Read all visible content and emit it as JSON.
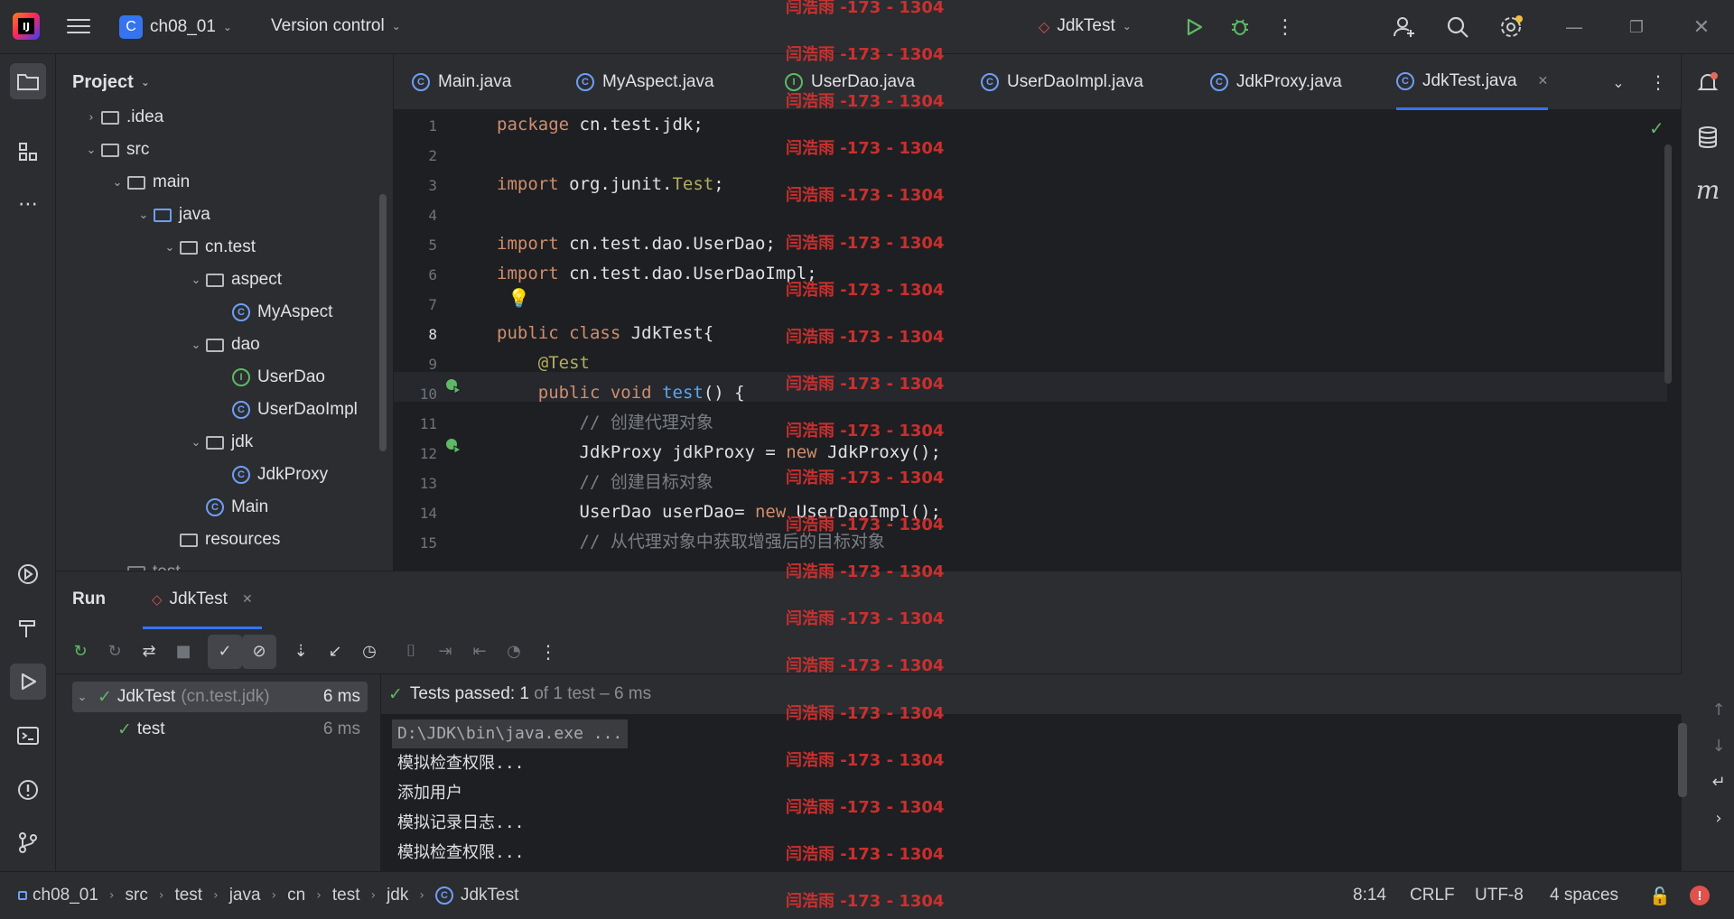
{
  "titlebar": {
    "project_badge": "C",
    "project_name": "ch08_01",
    "vcs_label": "Version control",
    "run_config": "JdkTest",
    "icons": [
      "menu-icon",
      "run-icon",
      "debug-icon",
      "more-icon",
      "add-user-icon",
      "search-icon",
      "settings-icon",
      "minimize-icon",
      "maximize-icon",
      "close-icon"
    ]
  },
  "watermark": "闫浩雨 -173 - 1304",
  "project_panel": {
    "title": "Project",
    "tree": [
      {
        "label": ".idea",
        "type": "folder",
        "depth": 2,
        "expanded": false
      },
      {
        "label": "src",
        "type": "folder",
        "depth": 2,
        "expanded": true
      },
      {
        "label": "main",
        "type": "folder",
        "depth": 3,
        "expanded": true
      },
      {
        "label": "java",
        "type": "source-folder",
        "depth": 4,
        "expanded": true
      },
      {
        "label": "cn.test",
        "type": "package",
        "depth": 5,
        "expanded": true
      },
      {
        "label": "aspect",
        "type": "package",
        "depth": 6,
        "expanded": true
      },
      {
        "label": "MyAspect",
        "type": "class",
        "depth": 7
      },
      {
        "label": "dao",
        "type": "package",
        "depth": 6,
        "expanded": true
      },
      {
        "label": "UserDao",
        "type": "interface",
        "depth": 7
      },
      {
        "label": "UserDaoImpl",
        "type": "class",
        "depth": 7
      },
      {
        "label": "jdk",
        "type": "package",
        "depth": 6,
        "expanded": true
      },
      {
        "label": "JdkProxy",
        "type": "class",
        "depth": 7
      },
      {
        "label": "Main",
        "type": "class",
        "depth": 6
      },
      {
        "label": "resources",
        "type": "resources",
        "depth": 5
      },
      {
        "label": "test",
        "type": "folder",
        "depth": 3,
        "expanded": true
      }
    ]
  },
  "editor": {
    "tabs": [
      {
        "label": "Main.java",
        "kind": "class"
      },
      {
        "label": "MyAspect.java",
        "kind": "class"
      },
      {
        "label": "UserDao.java",
        "kind": "interface"
      },
      {
        "label": "UserDaoImpl.java",
        "kind": "class"
      },
      {
        "label": "JdkProxy.java",
        "kind": "class"
      },
      {
        "label": "JdkTest.java",
        "kind": "class",
        "active": true
      }
    ],
    "current_line": 8,
    "lines": [
      {
        "n": "1",
        "html": "<span class='kw'>package</span> cn.test.jdk;"
      },
      {
        "n": "2",
        "html": ""
      },
      {
        "n": "3",
        "html": "<span class='kw'>import</span> org.junit.<span class='an'>Test</span>;"
      },
      {
        "n": "4",
        "html": ""
      },
      {
        "n": "5",
        "html": "<span class='kw'>import</span> cn.test.dao.UserDao;"
      },
      {
        "n": "6",
        "html": "<span class='kw'>import</span> cn.test.dao.UserDaoImpl;"
      },
      {
        "n": "7",
        "html": ""
      },
      {
        "n": "8",
        "html": "<span class='kw'>public class</span> JdkTest{"
      },
      {
        "n": "9",
        "html": "    <span class='an'>@Test</span>"
      },
      {
        "n": "10",
        "html": "    <span class='kw'>public void</span> <span class='fn'>test</span>() {"
      },
      {
        "n": "11",
        "html": "        <span class='cm'>// 创建代理对象</span>"
      },
      {
        "n": "12",
        "html": "        JdkProxy jdkProxy = <span class='kw'>new</span> JdkProxy();"
      },
      {
        "n": "13",
        "html": "        <span class='cm'>// 创建目标对象</span>"
      },
      {
        "n": "14",
        "html": "        UserDao userDao= <span class='kw'>new</span> UserDaoImpl();"
      },
      {
        "n": "15",
        "html": "        <span class='cm'>// 从代理对象中获取增强后的目标对象</span>"
      }
    ]
  },
  "run_panel": {
    "tab_run": "Run",
    "tab_config": "JdkTest",
    "tests": [
      {
        "name": "JdkTest",
        "detail": "(cn.test.jdk)",
        "time": "6 ms"
      },
      {
        "name": "test",
        "detail": "",
        "time": "6 ms"
      }
    ],
    "summary_prefix": "Tests passed: ",
    "summary_count": "1",
    "summary_suffix": " of 1 test – 6 ms",
    "console": [
      "D:\\JDK\\bin\\java.exe ...",
      "模拟检查权限...",
      "添加用户",
      "模拟记录日志...",
      "模拟检查权限..."
    ]
  },
  "statusbar": {
    "breadcrumb": [
      "ch08_01",
      "src",
      "test",
      "java",
      "cn",
      "test",
      "jdk",
      "JdkTest"
    ],
    "position": "8:14",
    "line_sep": "CRLF",
    "encoding": "UTF-8",
    "indent": "4 spaces"
  }
}
